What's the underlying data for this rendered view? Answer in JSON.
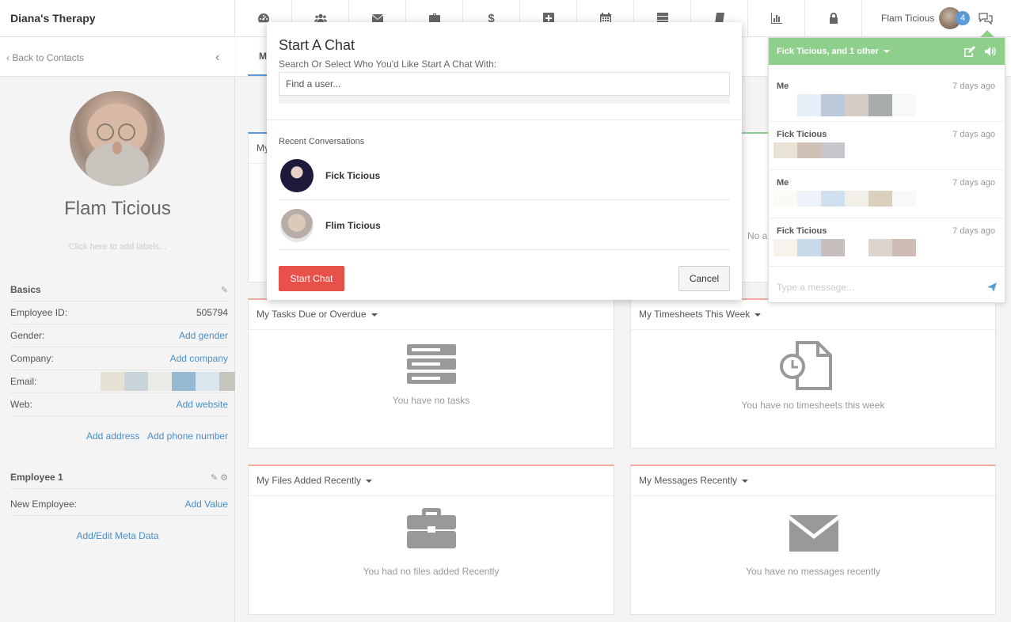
{
  "app": {
    "brand": "Diana's Therapy"
  },
  "nav": {
    "icons": [
      "dashboard-icon",
      "users-icon",
      "envelope-icon",
      "briefcase-icon",
      "dollar-icon",
      "plus-square-icon",
      "calendar-icon",
      "list-icon",
      "book-icon",
      "bar-chart-icon",
      "lock-icon"
    ]
  },
  "user": {
    "name": "Flam Ticious",
    "badge": "4"
  },
  "left": {
    "back_label": "Back to Contacts",
    "profile_name": "Flam Ticious",
    "labels_hint": "Click here to add labels...",
    "basics": {
      "title": "Basics",
      "employee_id_label": "Employee ID:",
      "employee_id_value": "505794",
      "gender_label": "Gender:",
      "gender_link": "Add gender",
      "company_label": "Company:",
      "company_link": "Add company",
      "email_label": "Email:",
      "web_label": "Web:",
      "web_link": "Add website",
      "address_link": "Add address",
      "phone_link": "Add phone number"
    },
    "employee": {
      "title": "Employee 1",
      "new_label": "New Employee:",
      "new_link": "Add Value",
      "meta_link": "Add/Edit Meta Data"
    }
  },
  "cards": {
    "tasks": {
      "title": "My Tasks Due or Overdue",
      "empty": "You have no tasks"
    },
    "timesheets": {
      "title": "My Timesheets This Week",
      "empty": "You have no timesheets this week"
    },
    "files": {
      "title": "My Files Added Recently",
      "empty": "You had no files added Recently"
    },
    "messages": {
      "title": "My Messages Recently",
      "empty": "You have no messages recently"
    },
    "partial_left": "My",
    "partial_right": "No a",
    "tab_partial": "M"
  },
  "modal": {
    "title": "Start A Chat",
    "subtitle": "Search Or Select Who You'd Like Start A Chat With:",
    "placeholder": "Find a user...",
    "recent_label": "Recent Conversations",
    "conversations": [
      {
        "name": "Fick Ticious"
      },
      {
        "name": "Flim Ticious"
      }
    ],
    "start_label": "Start Chat",
    "cancel_label": "Cancel"
  },
  "chat": {
    "header": "Fick Ticious, and 1 other",
    "messages": [
      {
        "who": "Me",
        "when": "7 days ago"
      },
      {
        "who": "Fick Ticious",
        "when": "7 days ago"
      },
      {
        "who": "Me",
        "when": "7 days ago"
      },
      {
        "who": "Fick Ticious",
        "when": "7 days ago"
      }
    ],
    "placeholder": "Type a message..."
  },
  "colors": {
    "accent_green": "#8fcf8c",
    "danger": "#e8504a",
    "link": "#4a8fc7",
    "badge": "#5b9bd5"
  }
}
